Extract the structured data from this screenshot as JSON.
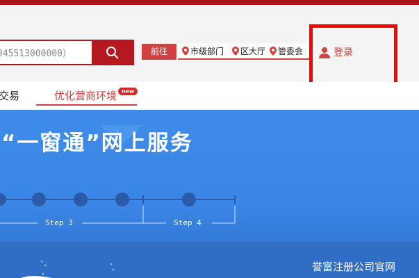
{
  "header": {
    "search": {
      "value": "045513000000）"
    },
    "goto": {
      "label": "前往",
      "links": [
        "市级部门",
        "区大厅",
        "管委会"
      ]
    },
    "login_label": "登录"
  },
  "nav": {
    "items": [
      {
        "label": "交易",
        "active": false
      },
      {
        "label": "优化营商环境",
        "active": true,
        "badge": "new"
      }
    ]
  },
  "hero": {
    "title": "“一窗通”网上服务",
    "steps": [
      "Step 3",
      "Step 4"
    ]
  },
  "watermark": "誉富注册公司官网",
  "colors": {
    "brand_red": "#b3191f",
    "accent_red": "#d24040",
    "hero_blue": "#3e8be8",
    "step_dot": "#2a5aa8"
  },
  "icons": [
    "search-icon",
    "location-pin-icon",
    "user-icon"
  ]
}
